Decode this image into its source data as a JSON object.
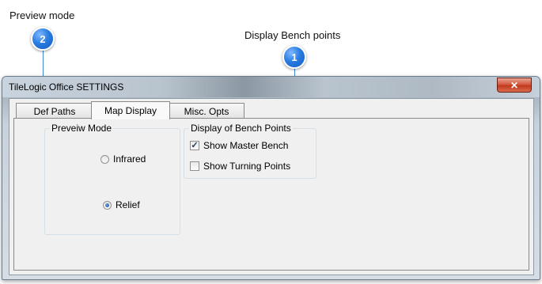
{
  "callouts": [
    {
      "number": "2",
      "label": "Preview mode"
    },
    {
      "number": "1",
      "label": "Display Bench points"
    }
  ],
  "window": {
    "title": "TileLogic Office SETTINGS",
    "close_glyph": "✕",
    "tabs": [
      "Def Paths",
      "Map Display",
      "Misc. Opts"
    ],
    "active_tab": "Map Display"
  },
  "preview_mode": {
    "title": "Preveiw Mode",
    "options": [
      {
        "label": "Infrared",
        "checked": false
      },
      {
        "label": "Relief",
        "checked": true
      }
    ]
  },
  "bench_points": {
    "title": "Display of Bench Points",
    "options": [
      {
        "label": "Show Master Bench",
        "checked": true,
        "mark": "✓"
      },
      {
        "label": "Show Turning Points",
        "checked": false,
        "mark": ""
      }
    ]
  },
  "colors": {
    "callout_blue": "#2a7de0",
    "window_frame": "#aeb8c2",
    "close_red": "#c2391e"
  }
}
